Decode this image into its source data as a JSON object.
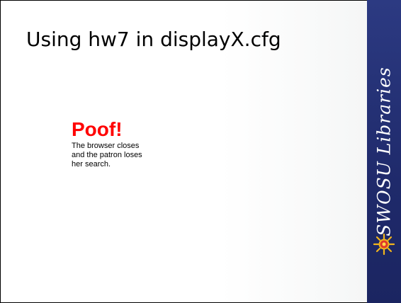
{
  "slide": {
    "title": "Using hw7 in displayX.cfg",
    "callout": {
      "heading": "Poof!",
      "body_lines": [
        "The browser closes",
        "and the patron loses",
        "her search."
      ]
    },
    "banner": {
      "text": "SWOSU Libraries",
      "icon": "sun-icon"
    },
    "colors": {
      "heading": "#ff0000",
      "banner_background": "#22306f",
      "banner_text": "#ffffff",
      "sun": "#f2b51c"
    }
  }
}
